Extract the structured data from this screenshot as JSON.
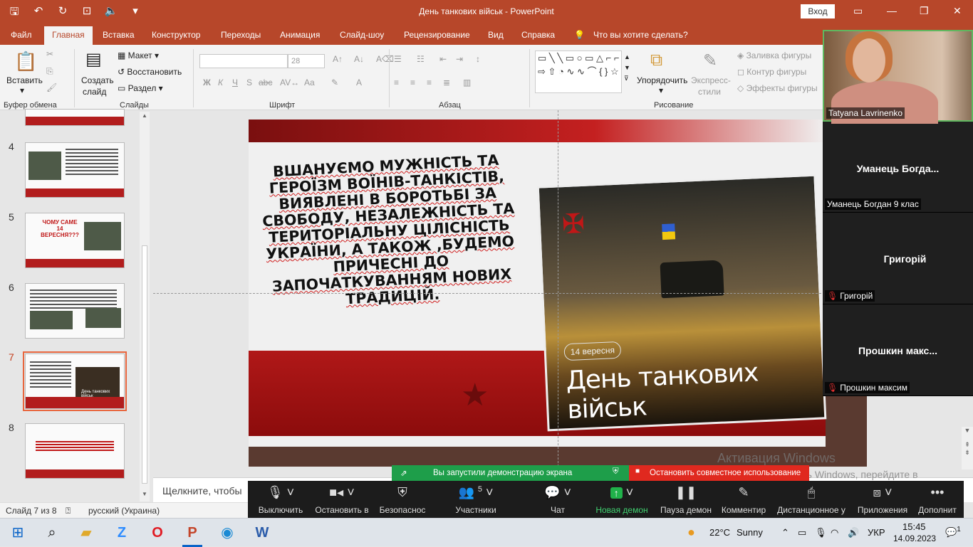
{
  "window": {
    "title": "День танкових військ  -  PowerPoint",
    "signin_label": "Вход"
  },
  "tabs": [
    {
      "label": "Файл"
    },
    {
      "label": "Главная"
    },
    {
      "label": "Вставка"
    },
    {
      "label": "Конструктор"
    },
    {
      "label": "Переходы"
    },
    {
      "label": "Анимация"
    },
    {
      "label": "Слайд-шоу"
    },
    {
      "label": "Рецензирование"
    },
    {
      "label": "Вид"
    },
    {
      "label": "Справка"
    }
  ],
  "tell_me": "Что вы хотите сделать?",
  "ribbon": {
    "paste": "Вставить",
    "new_slide_1": "Создать",
    "new_slide_2": "слайд",
    "layout": "Макет",
    "reset": "Восстановить",
    "section": "Раздел",
    "font_size": "28",
    "bold": "Ж",
    "italic": "К",
    "underline": "Ч",
    "shadow": "S",
    "strike": "abc",
    "case": "Aa",
    "arrange": "Упорядочить",
    "quick_styles_1": "Экспресс-",
    "quick_styles_2": "стили",
    "fill": "Заливка фигуры",
    "outline": "Контур фигуры",
    "effects": "Эффекты фигуры",
    "groups": {
      "clipboard": "Буфер обмена",
      "slides": "Слайды",
      "font": "Шрифт",
      "paragraph": "Абзац",
      "drawing": "Рисование"
    }
  },
  "slides_panel": {
    "thumbs": [
      {
        "num": "4"
      },
      {
        "num": "5",
        "text_1": "ЧОМУ САМЕ",
        "text_2": "14",
        "text_3": "ВЕРЕСНЯ???"
      },
      {
        "num": "6"
      },
      {
        "num": "7",
        "caption": "День танкових військ"
      },
      {
        "num": "8"
      }
    ]
  },
  "slide": {
    "body": "Вшануємо мужність та героїзм воїнів-танкістів, виявлені в боротьбі за свободу, незалежність та територіальну цілісність України, а також ,будемо причесні до започаткуванням нових традицій.",
    "date_badge": "14 вересня",
    "title": "День танкових військ"
  },
  "notes_placeholder": "Щелкните, чтобы",
  "status": {
    "slide_count": "Слайд 7 из 8",
    "language": "русский (Украина)"
  },
  "watermark": {
    "line1": "Активация Windows",
    "line2": "Чтобы активировать Windows, перейдите в раздел \"Параметры\"."
  },
  "share": {
    "green_label": "Вы запустили демонстрацию экрана",
    "red_label": "Остановить совместное использование"
  },
  "zoom": {
    "buttons": [
      {
        "label": "Выключить"
      },
      {
        "label": "Остановить в"
      },
      {
        "label": "Безопаснос"
      },
      {
        "label": "Участники",
        "count": "5"
      },
      {
        "label": "Чат"
      },
      {
        "label": "Новая демон"
      },
      {
        "label": "Пауза демон"
      },
      {
        "label": "Комментир"
      },
      {
        "label": "Дистанционное у"
      },
      {
        "label": "Приложения"
      },
      {
        "label": "Дополнит"
      }
    ]
  },
  "participants": [
    {
      "tag": "Tatyana Lavrinenko"
    },
    {
      "name": "Уманець  Богда...",
      "tag": "Уманець Богдан 9 клас"
    },
    {
      "name": "Григорій",
      "tag": "Григорій"
    },
    {
      "name": "Прошкин  макс...",
      "tag": "Прошкин максим"
    }
  ],
  "taskbar": {
    "weather_temp": "22°C",
    "weather_text": "Sunny",
    "lang": "УКР",
    "time": "15:45",
    "date": "14.09.2023",
    "notif_count": "1"
  }
}
